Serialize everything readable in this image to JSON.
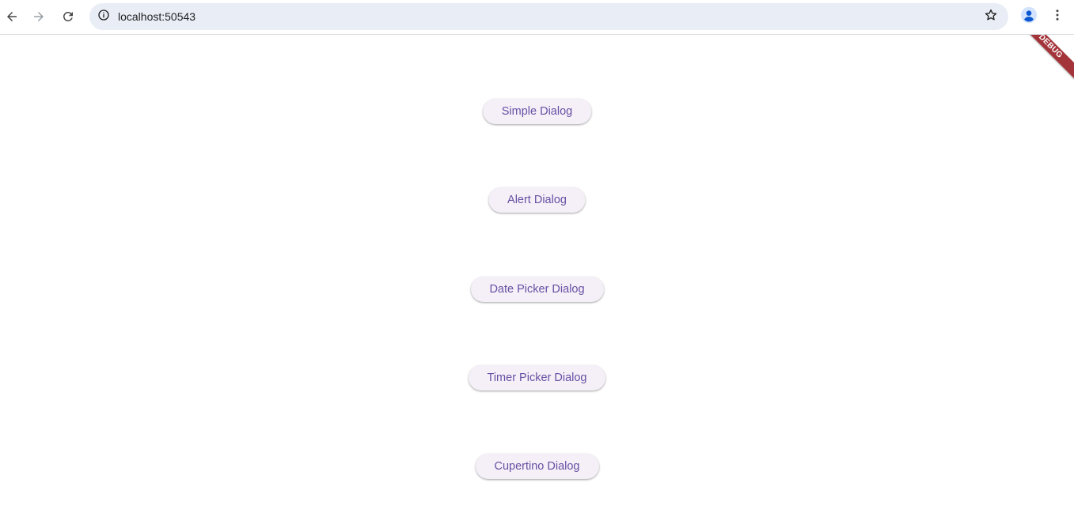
{
  "browser": {
    "url": "localhost:50543",
    "icons": {
      "back": "arrow-left-icon",
      "forward": "arrow-right-icon",
      "reload": "reload-icon",
      "site_info": "info-icon",
      "bookmark": "star-icon",
      "profile": "person-icon",
      "menu": "vertical-dots-icon"
    }
  },
  "app": {
    "debug_banner": "DEBUG",
    "buttons": [
      {
        "label": "Simple Dialog"
      },
      {
        "label": "Alert Dialog"
      },
      {
        "label": "Date Picker Dialog"
      },
      {
        "label": "Timer Picker Dialog"
      },
      {
        "label": "Cupertino Dialog"
      }
    ]
  },
  "colors": {
    "button_bg": "#f5eff7",
    "button_text": "#6750a4",
    "omnibox_bg": "#e9edf6",
    "debug_ribbon": "#a3343a",
    "profile_accent": "#0b57d0"
  }
}
